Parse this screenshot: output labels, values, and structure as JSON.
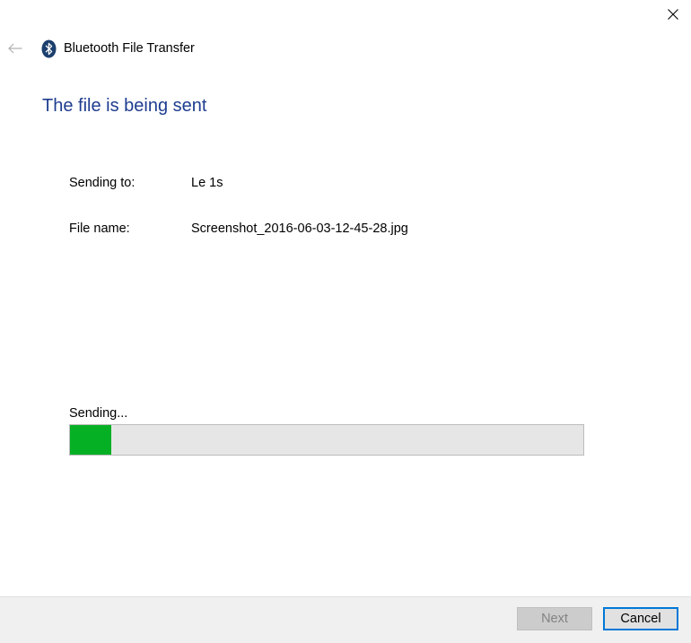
{
  "window": {
    "title": "Bluetooth File Transfer",
    "close_icon": "close-icon",
    "back_icon": "back-arrow-icon",
    "app_icon": "bluetooth-icon"
  },
  "main": {
    "heading": "The file is being sent",
    "sending_to_label": "Sending to:",
    "sending_to_value": "Le 1s",
    "file_name_label": "File name:",
    "file_name_value": "Screenshot_2016-06-03-12-45-28.jpg"
  },
  "progress": {
    "status": "Sending...",
    "fraction": 0.08,
    "color": "#06b025"
  },
  "footer": {
    "next_label": "Next",
    "cancel_label": "Cancel"
  },
  "colors": {
    "heading": "#1e3d8f",
    "accent": "#0078d7",
    "bluetooth_icon": "#1b3f6e"
  }
}
